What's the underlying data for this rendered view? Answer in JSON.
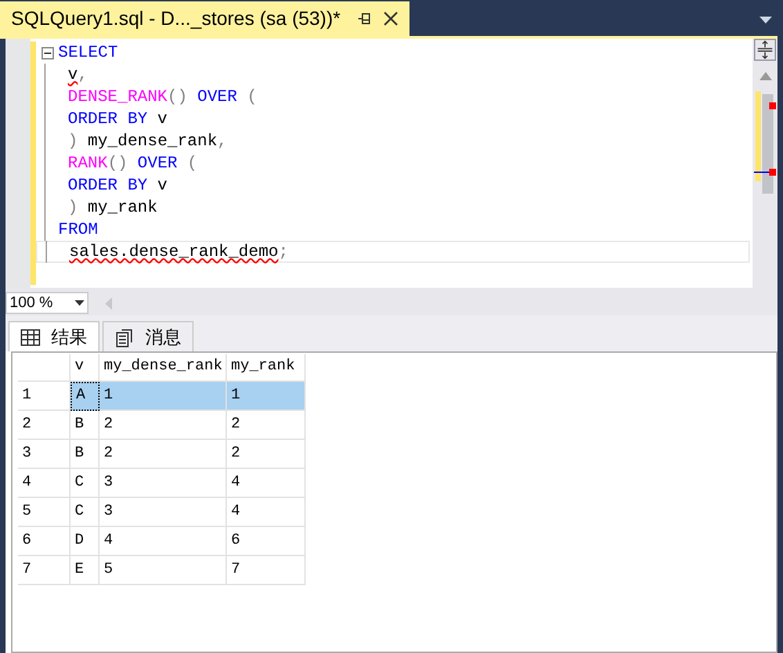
{
  "document_tab": {
    "title": "SQLQuery1.sql - D..._stores (sa (53))*",
    "pinned": false
  },
  "editor": {
    "lines": [
      {
        "indented": false,
        "folding": true,
        "tokens": [
          {
            "kind": "keyword",
            "text": "SELECT",
            "squiggle": false
          }
        ]
      },
      {
        "indented": true,
        "folding": false,
        "tokens": [
          {
            "kind": "plain",
            "text": "v",
            "squiggle": true
          },
          {
            "kind": "operator",
            "text": ",",
            "squiggle": false
          }
        ]
      },
      {
        "indented": true,
        "folding": false,
        "tokens": [
          {
            "kind": "function",
            "text": "DENSE_RANK",
            "squiggle": false
          },
          {
            "kind": "operator",
            "text": "() ",
            "squiggle": false
          },
          {
            "kind": "keyword",
            "text": "OVER",
            "squiggle": false
          },
          {
            "kind": "operator",
            "text": " (",
            "squiggle": false
          }
        ]
      },
      {
        "indented": true,
        "folding": false,
        "tokens": [
          {
            "kind": "keyword",
            "text": "ORDER BY",
            "squiggle": false
          },
          {
            "kind": "plain",
            "text": " v",
            "squiggle": false
          }
        ]
      },
      {
        "indented": true,
        "folding": false,
        "tokens": [
          {
            "kind": "operator",
            "text": ")",
            "squiggle": false
          },
          {
            "kind": "plain",
            "text": " my_dense_rank",
            "squiggle": false
          },
          {
            "kind": "operator",
            "text": ",",
            "squiggle": false
          }
        ]
      },
      {
        "indented": true,
        "folding": false,
        "tokens": [
          {
            "kind": "function",
            "text": "RANK",
            "squiggle": false
          },
          {
            "kind": "operator",
            "text": "() ",
            "squiggle": false
          },
          {
            "kind": "keyword",
            "text": "OVER",
            "squiggle": false
          },
          {
            "kind": "operator",
            "text": " (",
            "squiggle": false
          }
        ]
      },
      {
        "indented": true,
        "folding": false,
        "tokens": [
          {
            "kind": "keyword",
            "text": "ORDER BY",
            "squiggle": false
          },
          {
            "kind": "plain",
            "text": " v",
            "squiggle": false
          }
        ]
      },
      {
        "indented": true,
        "folding": false,
        "tokens": [
          {
            "kind": "operator",
            "text": ")",
            "squiggle": false
          },
          {
            "kind": "plain",
            "text": " my_rank",
            "squiggle": false
          }
        ]
      },
      {
        "indented": false,
        "folding": false,
        "tokens": [
          {
            "kind": "keyword",
            "text": "FROM",
            "squiggle": false
          }
        ]
      },
      {
        "indented": true,
        "folding": false,
        "current": true,
        "tokens": [
          {
            "kind": "plain",
            "text": "sales.dense_rank_demo",
            "squiggle": true
          },
          {
            "kind": "operator",
            "text": ";",
            "squiggle": false
          }
        ]
      }
    ]
  },
  "zoom": {
    "value": "100 %"
  },
  "result_tabs": [
    {
      "label": "结果",
      "selected": true,
      "kind": "grid"
    },
    {
      "label": "消息",
      "selected": false,
      "kind": "messages"
    }
  ],
  "table": {
    "columns": [
      "v",
      "my_dense_rank",
      "my_rank"
    ],
    "rows": [
      {
        "number": "1",
        "cells": [
          "A",
          "1",
          "1"
        ],
        "selected": true
      },
      {
        "number": "2",
        "cells": [
          "B",
          "2",
          "2"
        ],
        "selected": false
      },
      {
        "number": "3",
        "cells": [
          "B",
          "2",
          "2"
        ],
        "selected": false
      },
      {
        "number": "4",
        "cells": [
          "C",
          "3",
          "4"
        ],
        "selected": false
      },
      {
        "number": "5",
        "cells": [
          "C",
          "3",
          "4"
        ],
        "selected": false
      },
      {
        "number": "6",
        "cells": [
          "D",
          "4",
          "6"
        ],
        "selected": false
      },
      {
        "number": "7",
        "cells": [
          "E",
          "5",
          "7"
        ],
        "selected": false
      }
    ]
  }
}
